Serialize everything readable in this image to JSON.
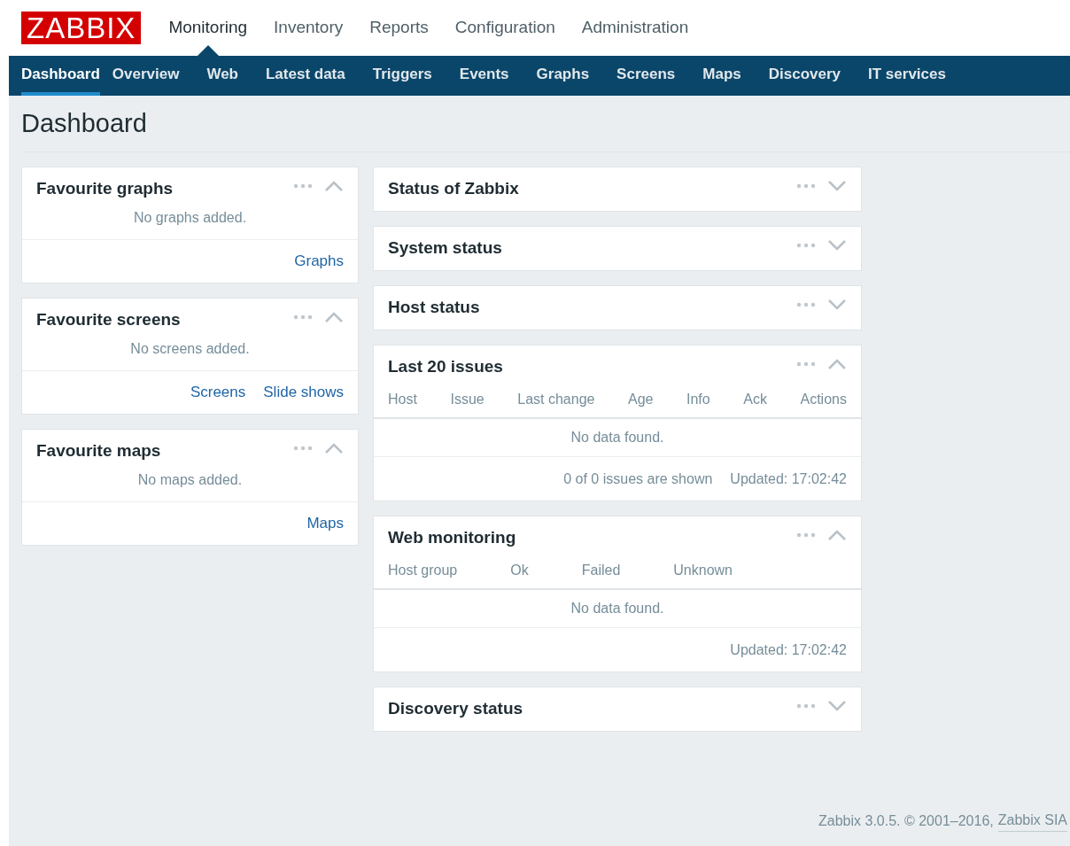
{
  "logo": "ZABBIX",
  "main_menu": [
    {
      "label": "Monitoring",
      "selected": true
    },
    {
      "label": "Inventory",
      "selected": false
    },
    {
      "label": "Reports",
      "selected": false
    },
    {
      "label": "Configuration",
      "selected": false
    },
    {
      "label": "Administration",
      "selected": false
    }
  ],
  "sub_menu": [
    {
      "label": "Dashboard",
      "selected": true
    },
    {
      "label": "Overview",
      "selected": false
    },
    {
      "label": "Web",
      "selected": false
    },
    {
      "label": "Latest data",
      "selected": false
    },
    {
      "label": "Triggers",
      "selected": false
    },
    {
      "label": "Events",
      "selected": false
    },
    {
      "label": "Graphs",
      "selected": false
    },
    {
      "label": "Screens",
      "selected": false
    },
    {
      "label": "Maps",
      "selected": false
    },
    {
      "label": "Discovery",
      "selected": false
    },
    {
      "label": "IT services",
      "selected": false
    }
  ],
  "page_title": "Dashboard",
  "left_widgets": [
    {
      "title": "Favourite graphs",
      "expanded": true,
      "kind": "message",
      "message": "No graphs added.",
      "links": [
        "Graphs"
      ]
    },
    {
      "title": "Favourite screens",
      "expanded": true,
      "kind": "message",
      "message": "No screens added.",
      "links": [
        "Screens",
        "Slide shows"
      ]
    },
    {
      "title": "Favourite maps",
      "expanded": true,
      "kind": "message",
      "message": "No maps added.",
      "links": [
        "Maps"
      ]
    }
  ],
  "right_widgets": [
    {
      "title": "Status of Zabbix",
      "expanded": false
    },
    {
      "title": "System status",
      "expanded": false
    },
    {
      "title": "Host status",
      "expanded": false
    },
    {
      "title": "Last 20 issues",
      "expanded": true,
      "kind": "table",
      "columns": [
        "Host",
        "Issue",
        "Last change",
        "Age",
        "Info",
        "Ack",
        "Actions"
      ],
      "message": "No data found.",
      "footer": [
        "0 of 0 issues are shown",
        "Updated: 17:02:42"
      ]
    },
    {
      "title": "Web monitoring",
      "expanded": true,
      "kind": "table",
      "columns": [
        "Host group",
        "Ok",
        "Failed",
        "Unknown"
      ],
      "message": "No data found.",
      "footer": [
        "Updated: 17:02:42"
      ]
    },
    {
      "title": "Discovery status",
      "expanded": false
    }
  ],
  "footer": {
    "text": "Zabbix 3.0.5. © 2001–2016,",
    "link": "Zabbix SIA"
  }
}
